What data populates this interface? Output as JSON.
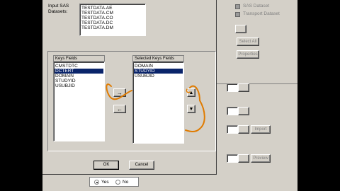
{
  "dataset": {
    "label": "Input SAS Datasets:",
    "items": [
      "TESTDATA.AE",
      "TESTDATA.CM",
      "TESTDATA.CO",
      "TESTDATA.DC",
      "TESTDATA.DM"
    ]
  },
  "keys_fields": {
    "header": "Keys Fields",
    "items": [
      "CMSTDTC",
      "DCTERT",
      "DOMAIN",
      "STUDYID",
      "USUBJID"
    ],
    "selected_index": 1
  },
  "selected_keys_fields": {
    "header": "Selected Keys Fields",
    "items": [
      "DOMAIN",
      "STUDYID",
      "USUBJID"
    ],
    "selected_index": 1
  },
  "buttons": {
    "ok": "OK",
    "cancel": "Cancel",
    "move_right": "→",
    "move_left": "←"
  },
  "right_panel": {
    "sas_dataset": "SAS Dataset",
    "transport_dataset": "Transport Dataset",
    "select_all": "Select All",
    "properties": "Properties",
    "import": "Import",
    "preview": "Preview"
  },
  "bottom": {
    "yes": "Yes",
    "no": "No",
    "selected": "yes"
  },
  "colors": {
    "annotation": "#e07b00",
    "selection": "#0a246a",
    "dialog": "#d4d0c8"
  }
}
